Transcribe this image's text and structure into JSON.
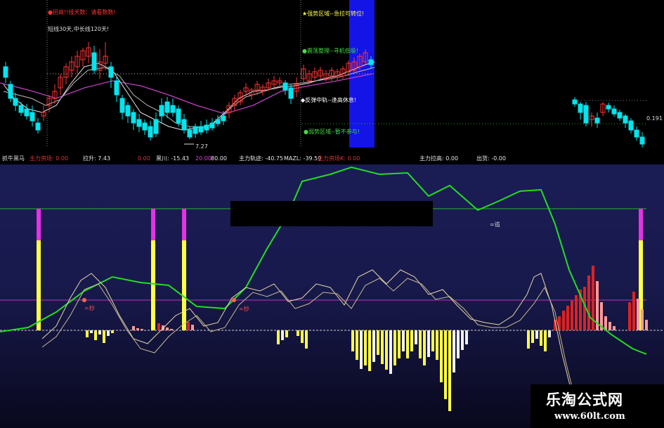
{
  "top_panel": {
    "annotations": {
      "red_warning": "●招商!!线天数：请看数数!",
      "ma_info": "短线30天,中长线120天!",
      "strong_zone": "★强势区域--急拉可转位!",
      "shake_up": "●震荡整理--寻机低吸!",
      "rebound": "◆反弹中轨--逢高休息!",
      "weak_zone": "●弱势区域--暂不参与!",
      "low_price": "7.27",
      "right_price": "0.191"
    }
  },
  "status_bar": {
    "items": [
      {
        "label": "抓牛黑马",
        "color": "#dddddd"
      },
      {
        "label": "主力资场: 0.00",
        "color": "#dd3333"
      },
      {
        "label": "拉升: 7.43",
        "color": "#e6e6e6"
      },
      {
        "label": "0.00",
        "color": "#dd3333"
      },
      {
        "label": "黑川: -15.43",
        "color": "#e6e6e6"
      },
      {
        "label": "20.00",
        "color": "#dd44dd"
      },
      {
        "label": "80.00",
        "color": "#e6e6e6"
      },
      {
        "label": "主力轨迹: -40.75",
        "color": "#e6e6e6"
      },
      {
        "label": "MAZL: -39.59",
        "color": "#e6e6e6"
      },
      {
        "label": "主力资场K: 0.00",
        "color": "#dd3333"
      },
      {
        "label": "主力拉高: 0.00",
        "color": "#e6e6e6"
      },
      {
        "label": "出货: -0.00",
        "color": "#e6e6e6"
      }
    ]
  },
  "bottom_panel": {
    "labels": {
      "jin_a": "=抄",
      "jin_b": "=抄",
      "zhui": "=追"
    }
  },
  "watermark": {
    "title": "乐淘公式网",
    "url": "www.60lt.com"
  },
  "colors": {
    "candle_up": "#ff3333",
    "candle_down": "#00e5ee",
    "highlight_blue": "#1414e6",
    "green_line": "#22dd22",
    "purple_line": "#aa33aa",
    "yellow_bar": "#ffff44",
    "magenta_cap": "#e333e3",
    "red_bar": "#dd2222"
  }
}
